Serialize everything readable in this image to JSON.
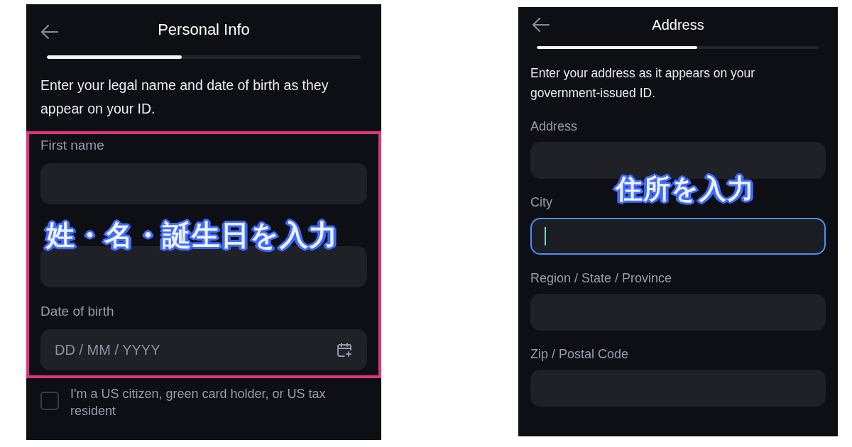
{
  "screens": [
    {
      "title": "Personal Info",
      "progress": {
        "level": 0.43
      },
      "description": "Enter your legal name and date of birth as they appear on your ID.",
      "highlighted": true,
      "fields": [
        {
          "kind": "text",
          "label": "First name",
          "focused": false
        },
        {
          "kind": "text",
          "focused": false
        },
        {
          "kind": "date",
          "label": "Date of birth",
          "placeholder": "DD / MM / YYYY",
          "focused": false
        }
      ],
      "checkbox": {
        "label": "I'm a US citizen, green card holder, or US tax resident",
        "checked": false
      },
      "caption": "姓・名・誕生日を入力"
    },
    {
      "title": "Address",
      "progress": {
        "level": 0.57
      },
      "description": "Enter your address as it appears on your government-issued ID.",
      "highlighted": false,
      "fields": [
        {
          "kind": "text",
          "label": "Address",
          "focused": false
        },
        {
          "kind": "text",
          "label": "City",
          "focused": true
        },
        {
          "kind": "text",
          "label": "Region / State / Province",
          "focused": false
        },
        {
          "kind": "text",
          "label": "Zip / Postal Code",
          "focused": false
        }
      ],
      "caption": "住所を入力"
    }
  ]
}
